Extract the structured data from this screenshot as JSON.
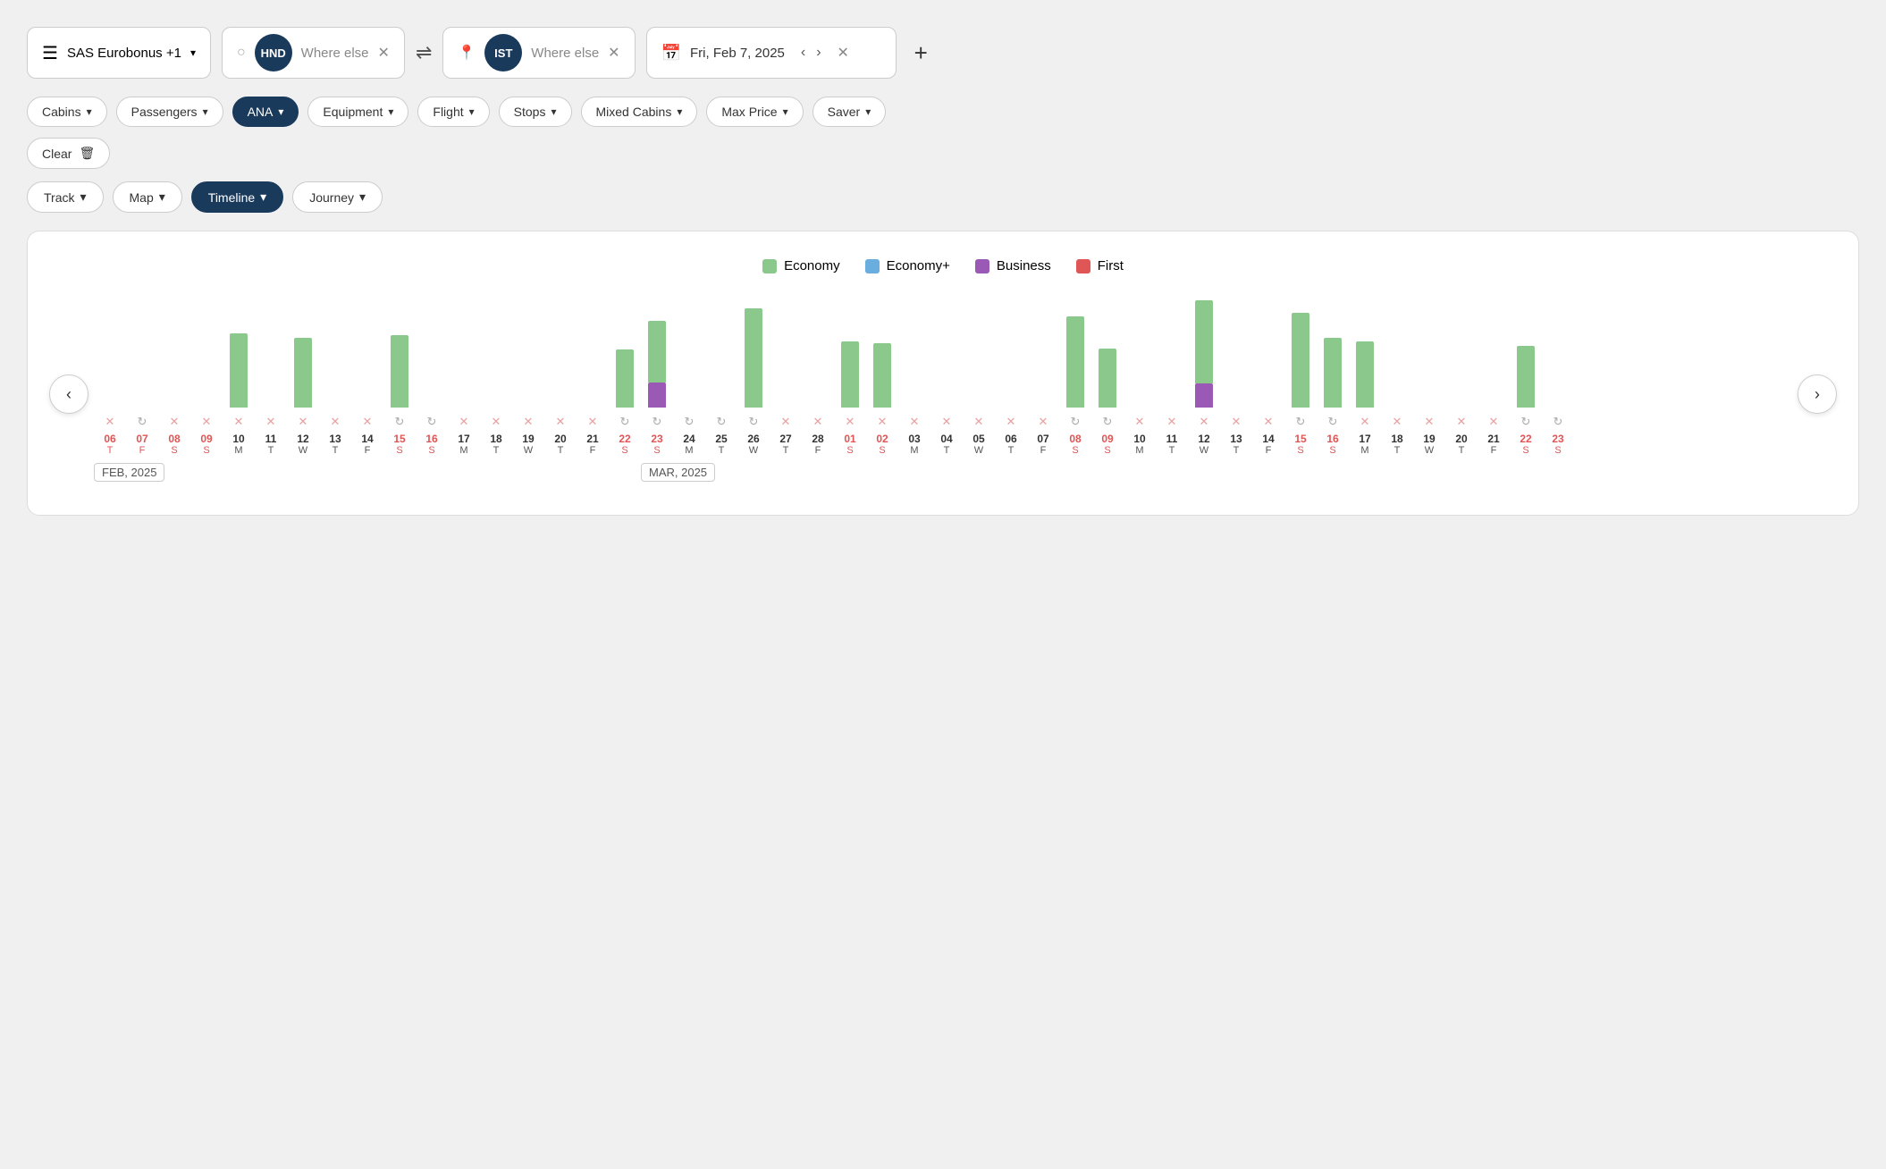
{
  "header": {
    "program": "SAS Eurobonus +1",
    "origin_code": "HND",
    "origin_placeholder": "Where else",
    "swap_icon": "⇌",
    "dest_code": "IST",
    "dest_placeholder": "Where else",
    "date": "Fri, Feb 7, 2025",
    "add_label": "+"
  },
  "filters": {
    "cabins_label": "Cabins",
    "passengers_label": "Passengers",
    "ana_label": "ANA",
    "equipment_label": "Equipment",
    "flight_label": "Flight",
    "stops_label": "Stops",
    "mixed_cabins_label": "Mixed Cabins",
    "max_price_label": "Max Price",
    "saver_label": "Saver",
    "clear_label": "Clear"
  },
  "views": {
    "track_label": "Track",
    "map_label": "Map",
    "timeline_label": "Timeline",
    "journey_label": "Journey"
  },
  "legend": {
    "economy_label": "Economy",
    "economy_plus_label": "Economy+",
    "business_label": "Business",
    "first_label": "First",
    "economy_color": "#8bc88b",
    "economy_plus_color": "#6aaddf",
    "business_color": "#9b59b6",
    "first_color": "#e05555"
  },
  "chart": {
    "months": [
      {
        "label": "FEB, 2025",
        "offset_index": 0
      },
      {
        "label": "MAR, 2025",
        "offset_index": 16
      }
    ],
    "bars": [
      {
        "date_num": "06",
        "date_day": "T",
        "red": true,
        "has_bar": false,
        "economy": 0,
        "business": 0,
        "icon": "x"
      },
      {
        "date_num": "07",
        "date_day": "F",
        "red": true,
        "has_bar": false,
        "economy": 0,
        "business": 0,
        "icon": "refresh"
      },
      {
        "date_num": "08",
        "date_day": "S",
        "red": true,
        "has_bar": false,
        "economy": 0,
        "business": 0,
        "icon": "x"
      },
      {
        "date_num": "09",
        "date_day": "S",
        "red": true,
        "has_bar": false,
        "economy": 0,
        "business": 0,
        "icon": "x"
      },
      {
        "date_num": "10",
        "date_day": "M",
        "red": false,
        "has_bar": true,
        "economy": 90,
        "business": 0,
        "icon": "x"
      },
      {
        "date_num": "11",
        "date_day": "T",
        "red": false,
        "has_bar": false,
        "economy": 0,
        "business": 0,
        "icon": "x"
      },
      {
        "date_num": "12",
        "date_day": "W",
        "red": false,
        "has_bar": true,
        "economy": 85,
        "business": 0,
        "icon": "x"
      },
      {
        "date_num": "13",
        "date_day": "T",
        "red": false,
        "has_bar": false,
        "economy": 0,
        "business": 0,
        "icon": "x"
      },
      {
        "date_num": "14",
        "date_day": "F",
        "red": false,
        "has_bar": false,
        "economy": 0,
        "business": 0,
        "icon": "x"
      },
      {
        "date_num": "15",
        "date_day": "S",
        "red": true,
        "has_bar": true,
        "economy": 88,
        "business": 0,
        "icon": "refresh"
      },
      {
        "date_num": "16",
        "date_day": "S",
        "red": true,
        "has_bar": false,
        "economy": 0,
        "business": 0,
        "icon": "refresh"
      },
      {
        "date_num": "17",
        "date_day": "M",
        "red": false,
        "has_bar": false,
        "economy": 0,
        "business": 0,
        "icon": "x"
      },
      {
        "date_num": "18",
        "date_day": "T",
        "red": false,
        "has_bar": false,
        "economy": 0,
        "business": 0,
        "icon": "x"
      },
      {
        "date_num": "19",
        "date_day": "W",
        "red": false,
        "has_bar": false,
        "economy": 0,
        "business": 0,
        "icon": "x"
      },
      {
        "date_num": "20",
        "date_day": "T",
        "red": false,
        "has_bar": false,
        "economy": 0,
        "business": 0,
        "icon": "x"
      },
      {
        "date_num": "21",
        "date_day": "F",
        "red": false,
        "has_bar": false,
        "economy": 0,
        "business": 0,
        "icon": "x"
      },
      {
        "date_num": "22",
        "date_day": "S",
        "red": true,
        "has_bar": true,
        "economy": 70,
        "business": 0,
        "icon": "refresh"
      },
      {
        "date_num": "23",
        "date_day": "S",
        "red": true,
        "has_bar": true,
        "economy": 75,
        "business": 30,
        "icon": "refresh"
      },
      {
        "date_num": "24",
        "date_day": "M",
        "red": false,
        "has_bar": false,
        "economy": 0,
        "business": 0,
        "icon": "refresh"
      },
      {
        "date_num": "25",
        "date_day": "T",
        "red": false,
        "has_bar": false,
        "economy": 0,
        "business": 0,
        "icon": "refresh"
      },
      {
        "date_num": "26",
        "date_day": "W",
        "red": false,
        "has_bar": true,
        "economy": 120,
        "business": 0,
        "icon": "refresh"
      },
      {
        "date_num": "27",
        "date_day": "T",
        "red": false,
        "has_bar": false,
        "economy": 0,
        "business": 0,
        "icon": "x"
      },
      {
        "date_num": "28",
        "date_day": "F",
        "red": false,
        "has_bar": false,
        "economy": 0,
        "business": 0,
        "icon": "x"
      },
      {
        "date_num": "01",
        "date_day": "S",
        "red": true,
        "has_bar": true,
        "economy": 80,
        "business": 0,
        "icon": "x"
      },
      {
        "date_num": "02",
        "date_day": "S",
        "red": true,
        "has_bar": true,
        "economy": 78,
        "business": 0,
        "icon": "x"
      },
      {
        "date_num": "03",
        "date_day": "M",
        "red": false,
        "has_bar": false,
        "economy": 0,
        "business": 0,
        "icon": "x"
      },
      {
        "date_num": "04",
        "date_day": "T",
        "red": false,
        "has_bar": false,
        "economy": 0,
        "business": 0,
        "icon": "x"
      },
      {
        "date_num": "05",
        "date_day": "W",
        "red": false,
        "has_bar": false,
        "economy": 0,
        "business": 0,
        "icon": "x"
      },
      {
        "date_num": "06",
        "date_day": "T",
        "red": false,
        "has_bar": false,
        "economy": 0,
        "business": 0,
        "icon": "x"
      },
      {
        "date_num": "07",
        "date_day": "F",
        "red": false,
        "has_bar": false,
        "economy": 0,
        "business": 0,
        "icon": "x"
      },
      {
        "date_num": "08",
        "date_day": "S",
        "red": true,
        "has_bar": true,
        "economy": 110,
        "business": 0,
        "icon": "refresh"
      },
      {
        "date_num": "09",
        "date_day": "S",
        "red": true,
        "has_bar": true,
        "economy": 72,
        "business": 0,
        "icon": "refresh"
      },
      {
        "date_num": "10",
        "date_day": "M",
        "red": false,
        "has_bar": false,
        "economy": 0,
        "business": 0,
        "icon": "x"
      },
      {
        "date_num": "11",
        "date_day": "T",
        "red": false,
        "has_bar": false,
        "economy": 0,
        "business": 0,
        "icon": "x"
      },
      {
        "date_num": "12",
        "date_day": "W",
        "red": false,
        "has_bar": true,
        "economy": 105,
        "business": 30,
        "icon": "x"
      },
      {
        "date_num": "13",
        "date_day": "T",
        "red": false,
        "has_bar": false,
        "economy": 0,
        "business": 0,
        "icon": "x"
      },
      {
        "date_num": "14",
        "date_day": "F",
        "red": false,
        "has_bar": false,
        "economy": 0,
        "business": 0,
        "icon": "x"
      },
      {
        "date_num": "15",
        "date_day": "S",
        "red": true,
        "has_bar": true,
        "economy": 115,
        "business": 0,
        "icon": "refresh"
      },
      {
        "date_num": "16",
        "date_day": "S",
        "red": true,
        "has_bar": true,
        "economy": 85,
        "business": 0,
        "icon": "refresh"
      },
      {
        "date_num": "17",
        "date_day": "M",
        "red": false,
        "has_bar": true,
        "economy": 80,
        "business": 0,
        "icon": "x"
      },
      {
        "date_num": "18",
        "date_day": "T",
        "red": false,
        "has_bar": false,
        "economy": 0,
        "business": 0,
        "icon": "x"
      },
      {
        "date_num": "19",
        "date_day": "W",
        "red": false,
        "has_bar": false,
        "economy": 0,
        "business": 0,
        "icon": "x"
      },
      {
        "date_num": "20",
        "date_day": "T",
        "red": false,
        "has_bar": false,
        "economy": 0,
        "business": 0,
        "icon": "x"
      },
      {
        "date_num": "21",
        "date_day": "F",
        "red": false,
        "has_bar": false,
        "economy": 0,
        "business": 0,
        "icon": "x"
      },
      {
        "date_num": "22",
        "date_day": "S",
        "red": true,
        "has_bar": true,
        "economy": 75,
        "business": 0,
        "icon": "refresh"
      },
      {
        "date_num": "23",
        "date_day": "S",
        "red": true,
        "has_bar": false,
        "economy": 0,
        "business": 0,
        "icon": "refresh"
      }
    ]
  }
}
